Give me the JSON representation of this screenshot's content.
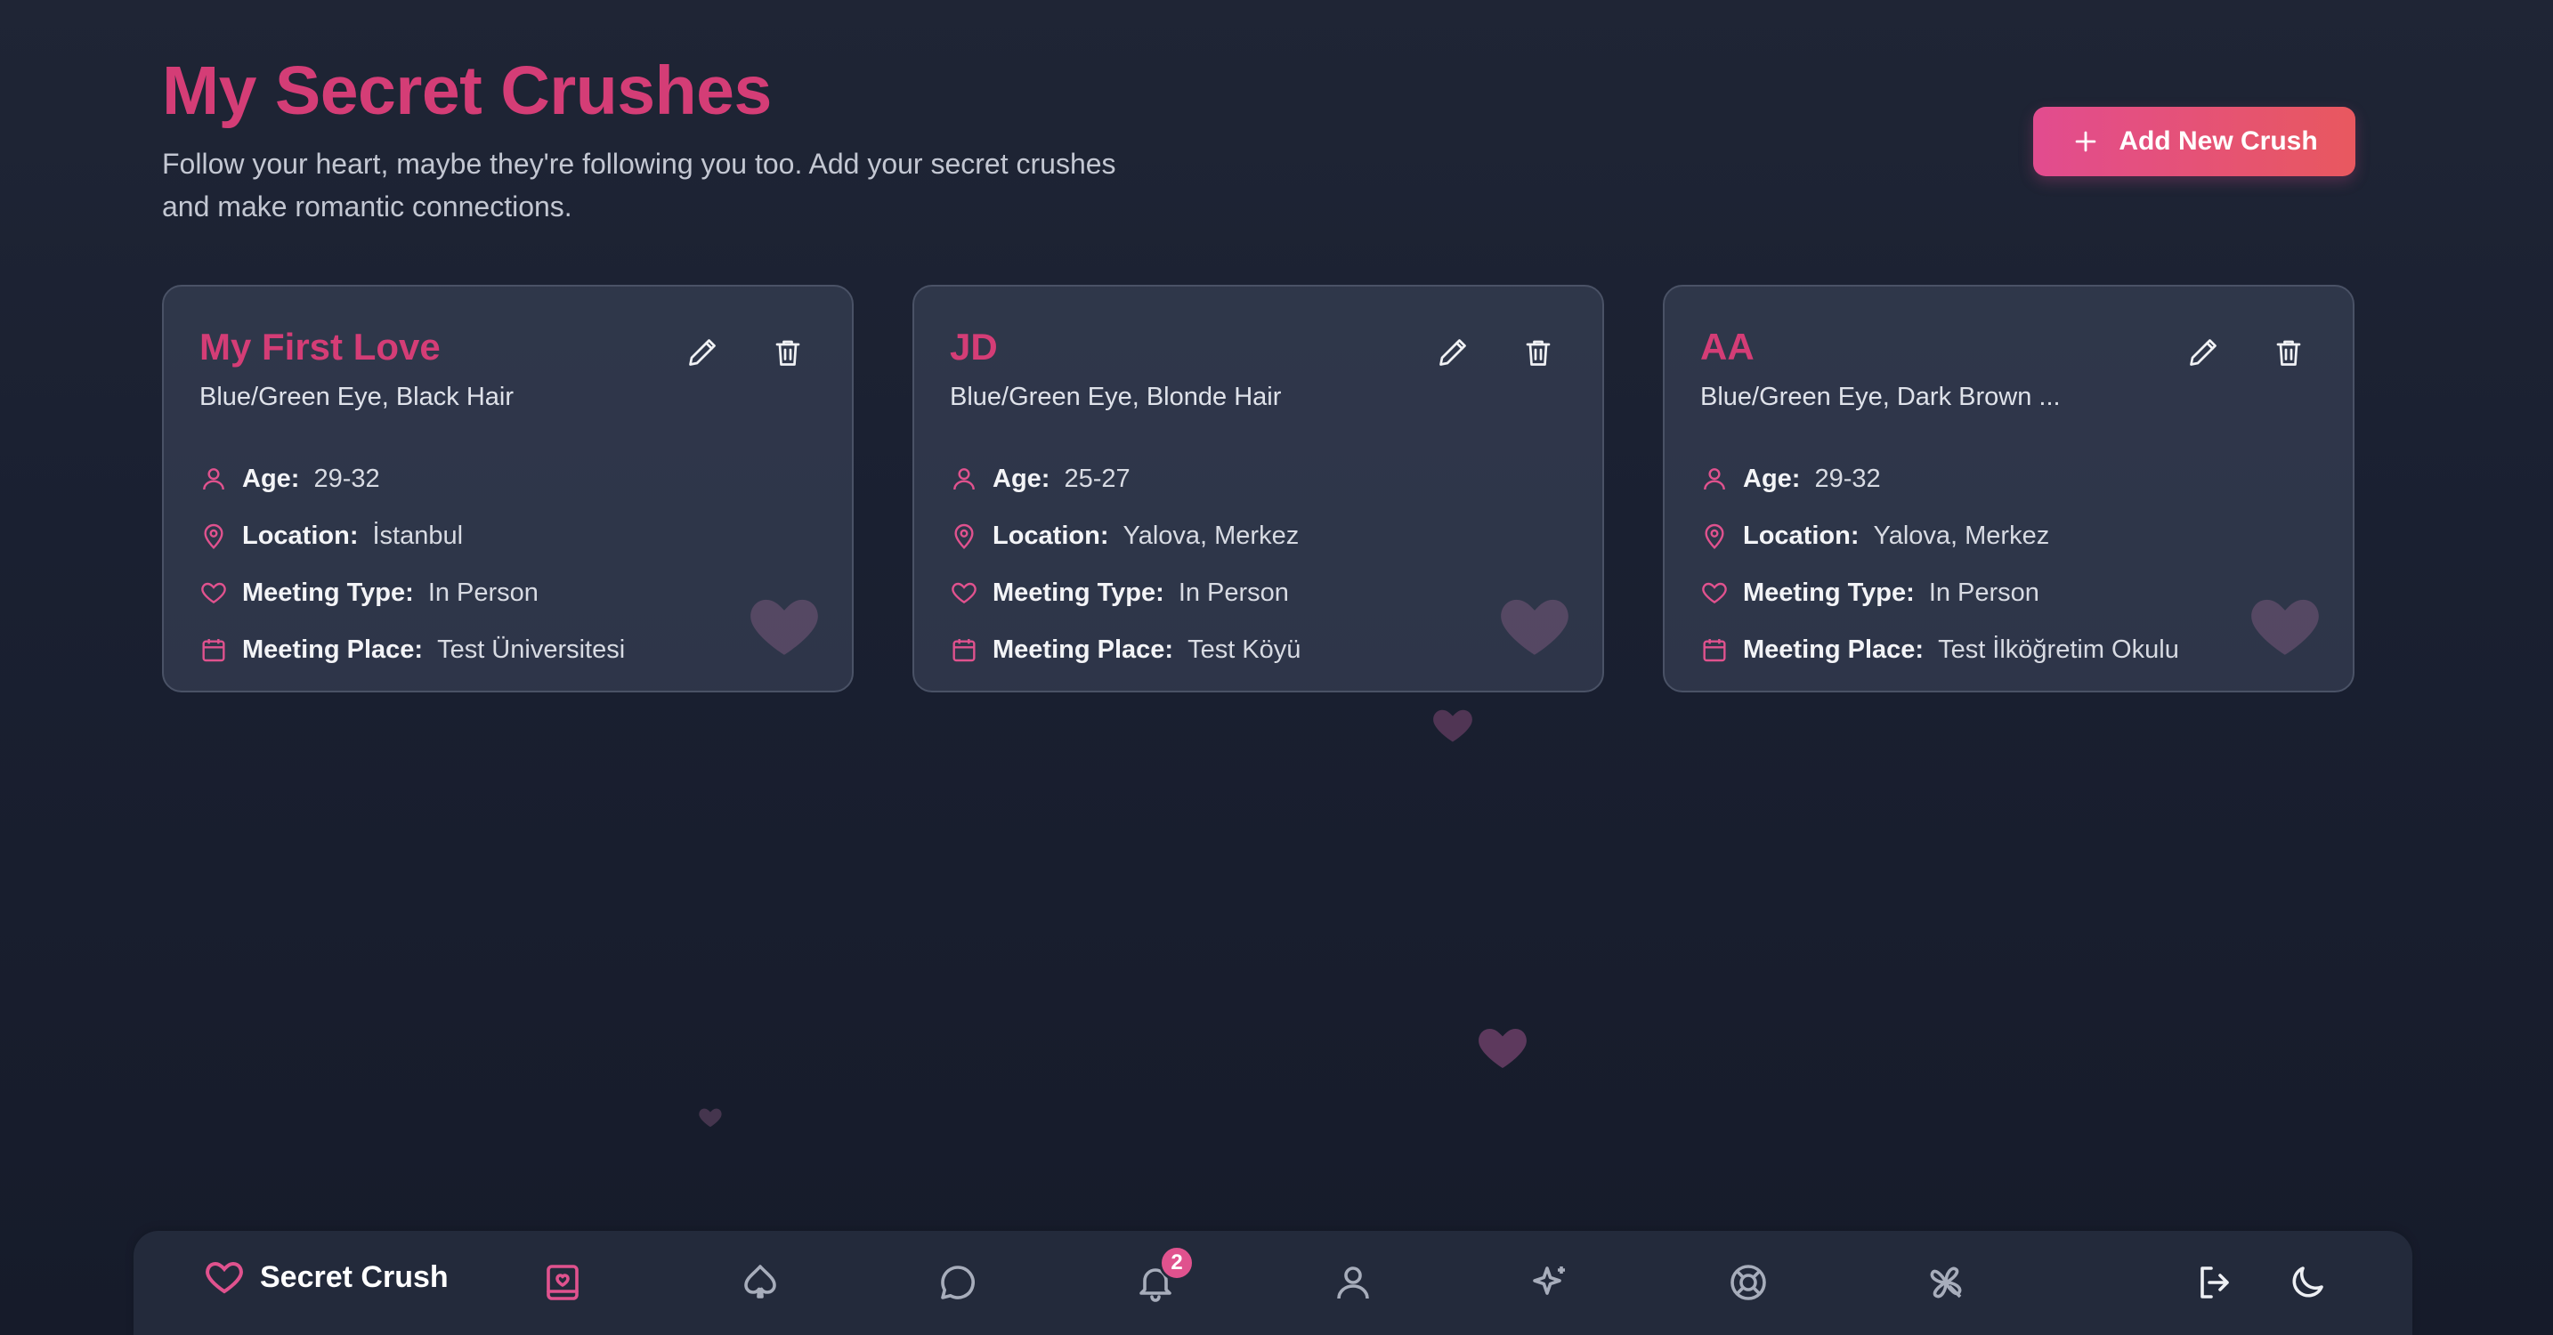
{
  "header": {
    "title": "My Secret Crushes",
    "subtitle": "Follow your heart, maybe they're following you too. Add your secret crushes and make romantic connections.",
    "add_button_label": "Add New Crush",
    "add_button_icon": "plus-icon"
  },
  "field_labels": {
    "age": "Age:",
    "location": "Location:",
    "meeting_type": "Meeting Type:",
    "meeting_place": "Meeting Place:"
  },
  "crushes": [
    {
      "name": "My First Love",
      "description": "Blue/Green Eye, Black Hair",
      "age": "29-32",
      "location": "İstanbul",
      "meeting_type": "In Person",
      "meeting_place": "Test Üniversitesi"
    },
    {
      "name": "JD",
      "description": "Blue/Green Eye, Blonde Hair",
      "age": "25-27",
      "location": "Yalova, Merkez",
      "meeting_type": "In Person",
      "meeting_place": "Test Köyü"
    },
    {
      "name": "AA",
      "description": "Blue/Green Eye, Dark Brown ...",
      "age": "29-32",
      "location": "Yalova, Merkez",
      "meeting_type": "In Person",
      "meeting_place": "Test İlköğretim Okulu"
    }
  ],
  "nav": {
    "brand": "Secret Crush",
    "brand_icon": "heart-icon",
    "items": [
      {
        "icon": "crush-book-icon",
        "active": true
      },
      {
        "icon": "spade-icon",
        "active": false
      },
      {
        "icon": "chat-icon",
        "active": false
      },
      {
        "icon": "bell-icon",
        "active": false,
        "badge": "2"
      },
      {
        "icon": "user-icon",
        "active": false
      },
      {
        "icon": "sparkles-icon",
        "active": false
      },
      {
        "icon": "lifebuoy-icon",
        "active": false
      },
      {
        "icon": "clover-icon",
        "active": false
      },
      {
        "icon": "logout-icon",
        "active": false
      },
      {
        "icon": "moon-icon",
        "active": false
      }
    ]
  },
  "colors": {
    "accent": "#d43d76",
    "accent_light": "#e0528e",
    "background": "#1a2031",
    "card": "#3c4458",
    "button_gradient_start": "#e24c8f",
    "button_gradient_end": "#e8585f"
  }
}
